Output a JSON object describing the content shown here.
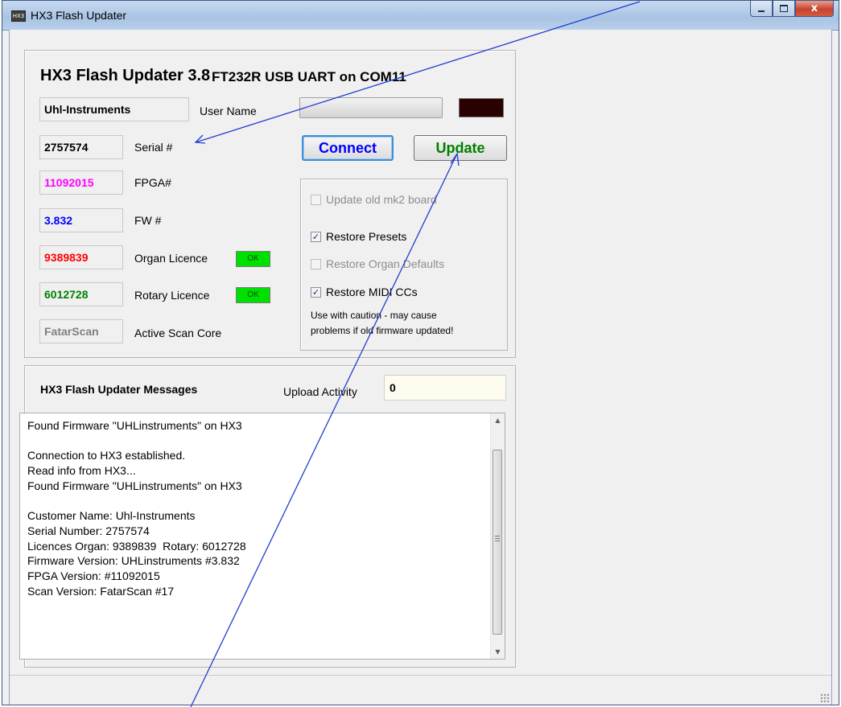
{
  "window": {
    "title": "HX3 Flash Updater",
    "icon": "app-icon",
    "icon_text": "HX3",
    "controls": [
      "minimize",
      "maximize",
      "close"
    ],
    "close_glyph": "x"
  },
  "header": {
    "title": "HX3 Flash Updater 3.8",
    "port": "FT232R USB UART on COM11"
  },
  "info": {
    "user_name_value": "Uhl-Instruments",
    "user_name_label": "User Name",
    "serial_value": "2757574",
    "serial_label": "Serial #",
    "fpga_value": "11092015",
    "fpga_label": "FPGA#",
    "fw_value": "3.832",
    "fw_label": "FW #",
    "organ_value": "9389839",
    "organ_label": "Organ Licence",
    "organ_status": "OK",
    "rotary_value": "6012728",
    "rotary_label": "Rotary Licence",
    "rotary_status": "OK",
    "scan_value": "FatarScan",
    "scan_label": "Active Scan Core"
  },
  "colors": {
    "fpga": "#ff00ff",
    "fw": "#0000ff",
    "organ": "#ff0000",
    "rotary": "#008000",
    "scan": "#808080",
    "connect": "#0000ff",
    "update": "#008000",
    "annotation": "#1f3fd0"
  },
  "actions": {
    "connect_label": "Connect",
    "update_label": "Update"
  },
  "progress": {
    "value": 0
  },
  "options": {
    "old_mk2": {
      "label": "Update old mk2 board",
      "checked": false,
      "enabled": false
    },
    "restore_presets": {
      "label": "Restore Presets",
      "checked": true,
      "enabled": true
    },
    "restore_organ_defaults": {
      "label": "Restore Organ Defaults",
      "checked": false,
      "enabled": false
    },
    "restore_midi_ccs": {
      "label": "Restore MIDI CCs",
      "checked": true,
      "enabled": true
    },
    "warning_line1": "Use with caution - may cause",
    "warning_line2": "problems if old firmware updated!"
  },
  "messages": {
    "title": "HX3 Flash Updater Messages",
    "upload_label": "Upload Activity",
    "upload_value": "0",
    "lines": [
      "Found Firmware \"UHLinstruments\" on HX3",
      "",
      "Connection to HX3 established.",
      "Read info from HX3...",
      "Found Firmware \"UHLinstruments\" on HX3",
      "",
      "Customer Name: Uhl-Instruments",
      "Serial Number: 2757574",
      "Licences Organ: 9389839  Rotary: 6012728",
      "Firmware Version: UHLinstruments #3.832",
      "FPGA Version: #11092015",
      "Scan Version: FatarScan #17"
    ]
  }
}
